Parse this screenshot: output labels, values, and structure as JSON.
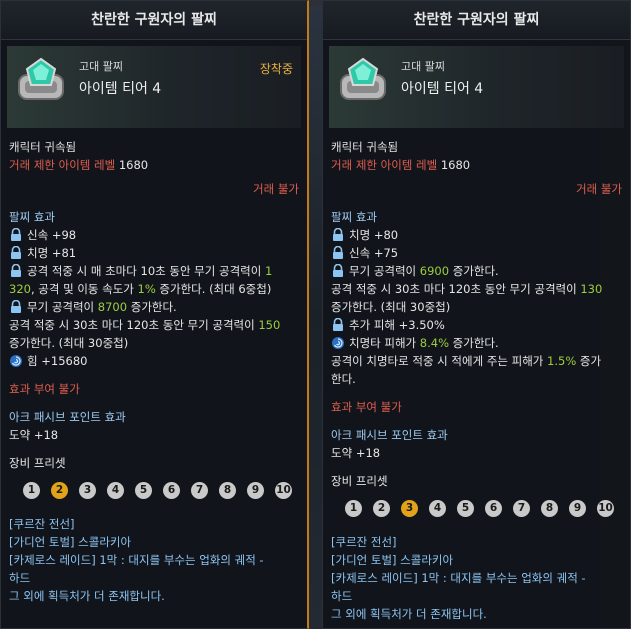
{
  "left": {
    "title": "찬란한 구원자의 팔찌",
    "grade": "고대 팔찌",
    "tier": "아이템 티어 4",
    "equipped": "장착중",
    "bound": "캐릭터 귀속됨",
    "trade_level_label": "거래 제한 아이템 레벨",
    "trade_level_value": "1680",
    "trade_disabled": "거래 불가",
    "effects_title": "팔찌 효과",
    "effects": {
      "e1": "신속 +98",
      "e2": "치명 +81",
      "e3_a": "공격 적중 시 매 초마다 10초 동안 무기 공격력이 ",
      "e3_b": "1",
      "e3_c": "320",
      "e3_d": ", 공격 및 이동 속도가 ",
      "e3_e": "1%",
      "e3_f": " 증가한다. (최대 6중첩)",
      "e4_a": "무기 공격력이 ",
      "e4_b": "8700",
      "e4_c": " 증가한다.",
      "e5_a": "공격 적중 시 30초 마다 120초 동안 무기 공격력이 ",
      "e5_b": "150",
      "e5_c": "증가한다. (최대 30중첩)",
      "e6": "힘 +15680"
    },
    "grant_disabled": "효과 부여 불가",
    "ark_title": "아크 패시브 포인트 효과",
    "ark_value": "도약 +18",
    "preset_title": "장비 프리셋",
    "presets": [
      "1",
      "2",
      "3",
      "4",
      "5",
      "6",
      "7",
      "8",
      "9",
      "10"
    ],
    "preset_active": 2,
    "sources": [
      "[쿠르잔 전선]",
      "[가디언 토벌] 스콜라키아",
      "[카제로스 레이드] 1막 : 대지를 부수는 업화의 궤적 -",
      "하드",
      "그 외에 획득처가 더 존재합니다."
    ]
  },
  "right": {
    "title": "찬란한 구원자의 팔찌",
    "grade": "고대 팔찌",
    "tier": "아이템 티어 4",
    "bound": "캐릭터 귀속됨",
    "trade_level_label": "거래 제한 아이템 레벨",
    "trade_level_value": "1680",
    "trade_disabled": "거래 불가",
    "effects_title": "팔찌 효과",
    "effects": {
      "e1": "치명 +80",
      "e2": "신속 +75",
      "e3_a": "무기 공격력이 ",
      "e3_b": "6900",
      "e3_c": " 증가한다.",
      "e4_a": "공격 적중 시 30초 마다 120초 동안 무기 공격력이 ",
      "e4_b": "130",
      "e4_c": "증가한다. (최대 30중첩)",
      "e5": "추가 피해 +3.50%",
      "e6_a": "치명타 피해가 ",
      "e6_b": "8.4%",
      "e6_c": " 증가한다.",
      "e7_a": "공격이 치명타로 적중 시 적에게 주는 피해가 ",
      "e7_b": "1.5%",
      "e7_c": " 증가",
      "e7_d": "한다."
    },
    "grant_disabled": "효과 부여 불가",
    "ark_title": "아크 패시브 포인트 효과",
    "ark_value": "도약 +18",
    "preset_title": "장비 프리셋",
    "presets": [
      "1",
      "2",
      "3",
      "4",
      "5",
      "6",
      "7",
      "8",
      "9",
      "10"
    ],
    "preset_active": 3,
    "sources": [
      "[쿠르잔 전선]",
      "[가디언 토벌] 스콜라키아",
      "[카제로스 레이드] 1막 : 대지를 부수는 업화의 궤적 -",
      "하드",
      "그 외에 획득처가 더 존재합니다."
    ]
  },
  "colors": {
    "equipped": "#e8b040",
    "red": "#e05d4e",
    "green": "#9ccd3f",
    "section": "#9ecbf2",
    "preset_active": "#e2a21a"
  }
}
